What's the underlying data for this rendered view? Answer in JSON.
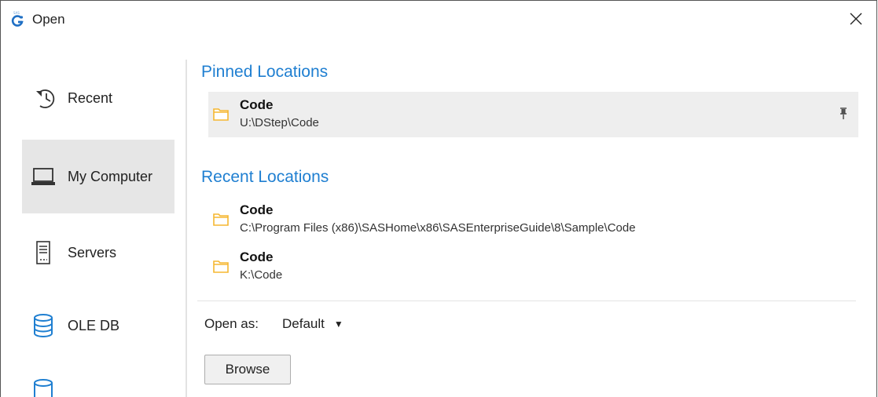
{
  "window": {
    "title": "Open",
    "app_icon": "sas-eg-icon",
    "close_icon": "close-icon"
  },
  "sidebar": {
    "items": [
      {
        "label": "Recent",
        "icon": "recent-history-icon",
        "selected": false
      },
      {
        "label": "My Computer",
        "icon": "laptop-icon",
        "selected": true
      },
      {
        "label": "Servers",
        "icon": "server-icon",
        "selected": false
      },
      {
        "label": "OLE DB",
        "icon": "database-icon",
        "selected": false
      },
      {
        "label": "",
        "icon": "database-icon",
        "selected": false
      }
    ]
  },
  "main": {
    "pinned_title": "Pinned Locations",
    "pinned": [
      {
        "name": "Code",
        "path": "U:\\DStep\\Code"
      }
    ],
    "recent_title": "Recent Locations",
    "recent": [
      {
        "name": "Code",
        "path": "C:\\Program Files (x86)\\SASHome\\x86\\SASEnterpriseGuide\\8\\Sample\\Code"
      },
      {
        "name": "Code",
        "path": "K:\\Code"
      }
    ],
    "open_as_label": "Open as:",
    "open_as_value": "Default",
    "browse_label": "Browse"
  },
  "colors": {
    "accent": "#1f7fd1",
    "folder": "#f5b731",
    "selected_bg": "#e6e6e6"
  }
}
